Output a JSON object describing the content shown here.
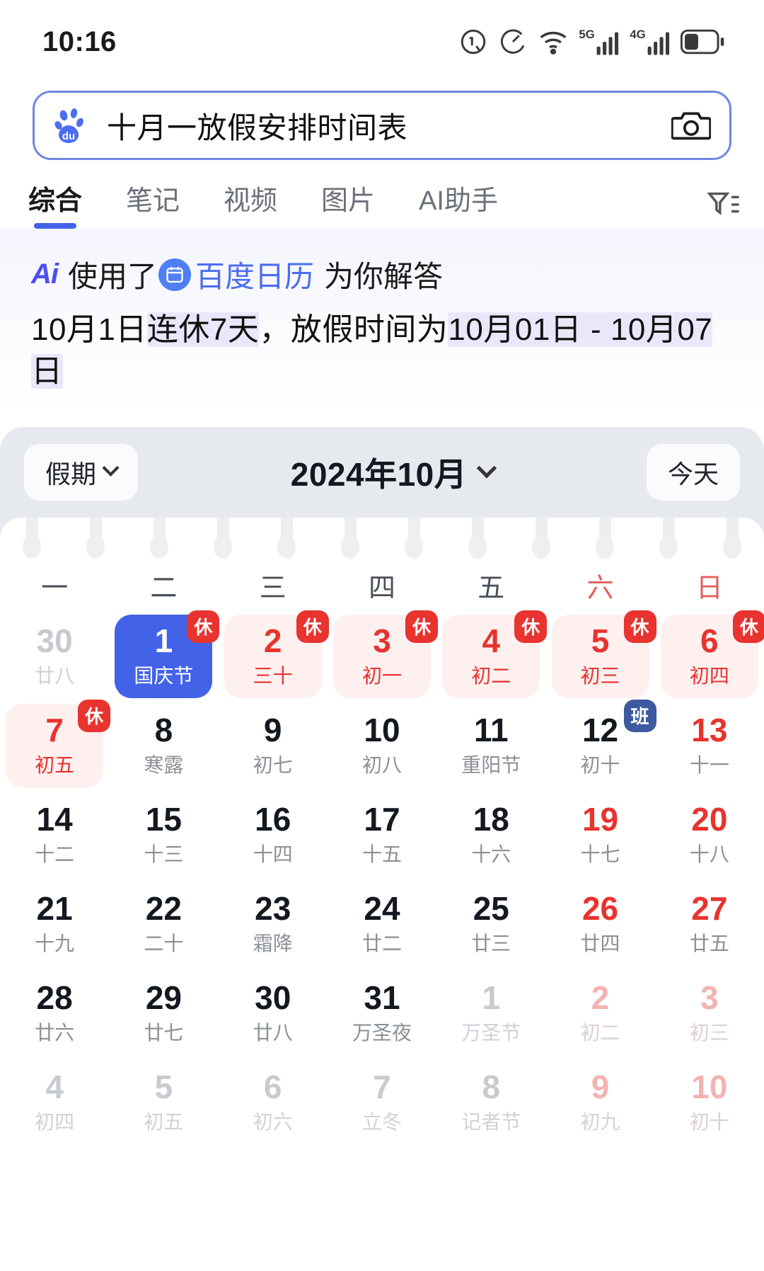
{
  "status": {
    "time": "10:16",
    "icons": [
      "alarm-icon",
      "speed-icon",
      "wifi-icon",
      "5g-signal-icon",
      "4g-signal-icon",
      "battery-icon"
    ]
  },
  "search": {
    "logo": "baidu-paw-logo",
    "query": "十月一放假安排时间表",
    "camera_icon": "camera-icon"
  },
  "tabs": [
    {
      "label": "综合",
      "active": true
    },
    {
      "label": "笔记",
      "active": false
    },
    {
      "label": "视频",
      "active": false
    },
    {
      "label": "图片",
      "active": false
    },
    {
      "label": "AI助手",
      "active": false
    }
  ],
  "filter_icon": "filter-icon",
  "ai": {
    "brand": "Ai",
    "prefix": "使用了",
    "source_icon": "calendar-chip-icon",
    "source": "百度日历",
    "suffix": "为你解答",
    "answer_pre": "10月1日",
    "answer_hl1": "连休7天",
    "answer_mid": "，放假时间为",
    "answer_hl2": "10月01日 - 10月07日"
  },
  "calendar": {
    "filter_label": "假期",
    "title": "2024年10月",
    "today_label": "今天",
    "weekdays": [
      {
        "label": "一",
        "weekend": false
      },
      {
        "label": "二",
        "weekend": false
      },
      {
        "label": "三",
        "weekend": false
      },
      {
        "label": "四",
        "weekend": false
      },
      {
        "label": "五",
        "weekend": false
      },
      {
        "label": "六",
        "weekend": true
      },
      {
        "label": "日",
        "weekend": true
      }
    ],
    "days": [
      {
        "num": "30",
        "sub": "廿八",
        "style": "c-out"
      },
      {
        "num": "1",
        "sub": "国庆节",
        "style": "c-sel",
        "badge": "休",
        "badge_type": "rest"
      },
      {
        "num": "2",
        "sub": "三十",
        "style": "c-red c-rest",
        "badge": "休",
        "badge_type": "rest"
      },
      {
        "num": "3",
        "sub": "初一",
        "style": "c-red c-rest",
        "badge": "休",
        "badge_type": "rest"
      },
      {
        "num": "4",
        "sub": "初二",
        "style": "c-red c-rest",
        "badge": "休",
        "badge_type": "rest"
      },
      {
        "num": "5",
        "sub": "初三",
        "style": "c-red c-rest",
        "badge": "休",
        "badge_type": "rest"
      },
      {
        "num": "6",
        "sub": "初四",
        "style": "c-red c-rest",
        "badge": "休",
        "badge_type": "rest"
      },
      {
        "num": "7",
        "sub": "初五",
        "style": "c-red c-rest",
        "badge": "休",
        "badge_type": "rest"
      },
      {
        "num": "8",
        "sub": "寒露",
        "style": ""
      },
      {
        "num": "9",
        "sub": "初七",
        "style": ""
      },
      {
        "num": "10",
        "sub": "初八",
        "style": ""
      },
      {
        "num": "11",
        "sub": "重阳节",
        "style": ""
      },
      {
        "num": "12",
        "sub": "初十",
        "style": "",
        "badge": "班",
        "badge_type": "work"
      },
      {
        "num": "13",
        "sub": "十一",
        "style": "c-weekend"
      },
      {
        "num": "14",
        "sub": "十二",
        "style": ""
      },
      {
        "num": "15",
        "sub": "十三",
        "style": ""
      },
      {
        "num": "16",
        "sub": "十四",
        "style": ""
      },
      {
        "num": "17",
        "sub": "十五",
        "style": ""
      },
      {
        "num": "18",
        "sub": "十六",
        "style": ""
      },
      {
        "num": "19",
        "sub": "十七",
        "style": "c-weekend"
      },
      {
        "num": "20",
        "sub": "十八",
        "style": "c-weekend"
      },
      {
        "num": "21",
        "sub": "十九",
        "style": ""
      },
      {
        "num": "22",
        "sub": "二十",
        "style": ""
      },
      {
        "num": "23",
        "sub": "霜降",
        "style": ""
      },
      {
        "num": "24",
        "sub": "廿二",
        "style": ""
      },
      {
        "num": "25",
        "sub": "廿三",
        "style": ""
      },
      {
        "num": "26",
        "sub": "廿四",
        "style": "c-weekend"
      },
      {
        "num": "27",
        "sub": "廿五",
        "style": "c-weekend"
      },
      {
        "num": "28",
        "sub": "廿六",
        "style": ""
      },
      {
        "num": "29",
        "sub": "廿七",
        "style": ""
      },
      {
        "num": "30",
        "sub": "廿八",
        "style": ""
      },
      {
        "num": "31",
        "sub": "万圣夜",
        "style": ""
      },
      {
        "num": "1",
        "sub": "万圣节",
        "style": "c-out"
      },
      {
        "num": "2",
        "sub": "初二",
        "style": "c-outred"
      },
      {
        "num": "3",
        "sub": "初三",
        "style": "c-outred"
      },
      {
        "num": "4",
        "sub": "初四",
        "style": "c-out"
      },
      {
        "num": "5",
        "sub": "初五",
        "style": "c-out"
      },
      {
        "num": "6",
        "sub": "初六",
        "style": "c-out"
      },
      {
        "num": "7",
        "sub": "立冬",
        "style": "c-out"
      },
      {
        "num": "8",
        "sub": "记者节",
        "style": "c-out"
      },
      {
        "num": "9",
        "sub": "初九",
        "style": "c-outred"
      },
      {
        "num": "10",
        "sub": "初十",
        "style": "c-outred"
      }
    ]
  },
  "colors": {
    "accent_blue": "#4263e8",
    "holiday_red": "#e8332f",
    "work_badge": "#3d5a9e",
    "card_bg": "#e6e9ee",
    "highlight": "#e9e8fb"
  }
}
